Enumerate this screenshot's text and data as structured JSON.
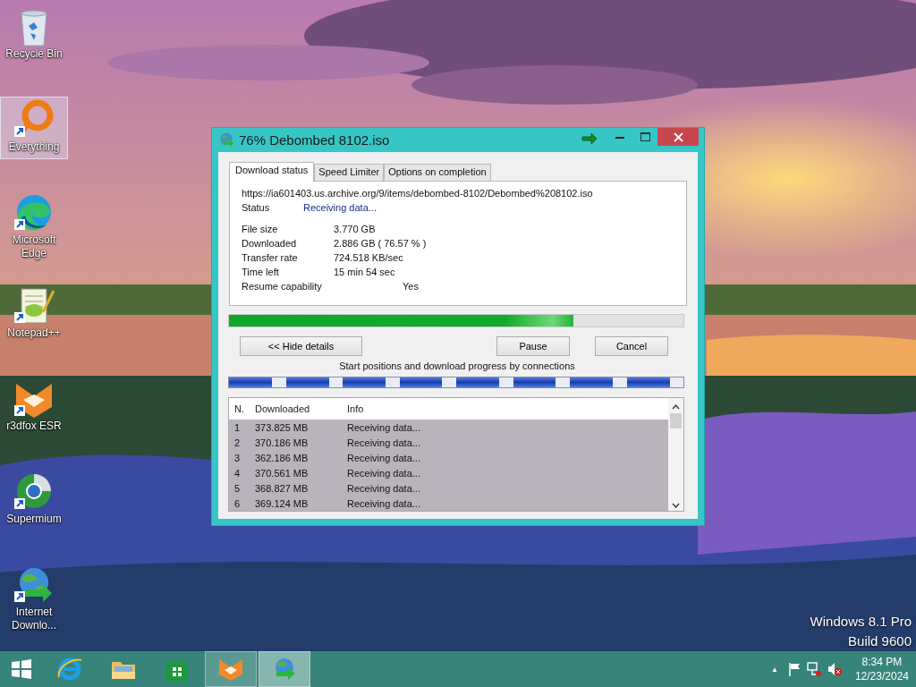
{
  "desktop_icons": [
    {
      "label": "Recycle Bin",
      "kind": "bin",
      "shortcut": false,
      "selected": false
    },
    {
      "label": "Everything",
      "kind": "ring",
      "shortcut": true,
      "selected": true
    },
    {
      "label": "Microsoft Edge",
      "kind": "wave",
      "shortcut": true,
      "selected": false
    },
    {
      "label": "Notepad++",
      "kind": "notepad",
      "shortcut": true,
      "selected": false
    },
    {
      "label": "r3dfox ESR",
      "kind": "fox",
      "shortcut": true,
      "selected": false
    },
    {
      "label": "Supermium",
      "kind": "chrome",
      "shortcut": true,
      "selected": false
    },
    {
      "label": "Internet Downlo...",
      "kind": "globe",
      "shortcut": true,
      "selected": false
    }
  ],
  "window": {
    "title": "76% Debombed 8102.iso",
    "tabs": [
      {
        "label": "Download status",
        "selected": true
      },
      {
        "label": "Speed Limiter",
        "selected": false
      },
      {
        "label": "Options on completion",
        "selected": false
      }
    ],
    "url": "https://ia601403.us.archive.org/9/items/debombed-8102/Debombed%208102.iso",
    "status": {
      "label": "Status",
      "value": "Receiving data..."
    },
    "details": [
      {
        "label": "File size",
        "value": "3.770  GB",
        "kind": "metric"
      },
      {
        "label": "Downloaded",
        "value": "2.886  GB  ( 76.57 % )",
        "kind": "metric"
      },
      {
        "label": "Transfer rate",
        "value": "724.518  KB/sec",
        "kind": "metric"
      },
      {
        "label": "Time left",
        "value": "15 min 54 sec",
        "kind": "metric"
      },
      {
        "label": "Resume capability",
        "value": "Yes",
        "kind": "capability"
      }
    ],
    "progress": {
      "level": 0.757
    },
    "buttons": [
      {
        "label": "<< Hide details",
        "kind": "details"
      },
      {
        "label": "Pause",
        "kind": "action"
      },
      {
        "label": "Cancel",
        "kind": "action"
      }
    ],
    "connections_caption": "Start positions and download progress by connections",
    "connection_segments": [
      {
        "level": 0.76
      },
      {
        "level": 0.76
      },
      {
        "level": 0.76
      },
      {
        "level": 0.75
      },
      {
        "level": 0.75
      },
      {
        "level": 0.75
      },
      {
        "level": 0.75
      },
      {
        "level": 0.76
      }
    ],
    "table": {
      "columns": [
        "N.",
        "Downloaded",
        "Info"
      ],
      "rows": [
        {
          "cells": [
            "1",
            "373.825  MB",
            "Receiving data..."
          ],
          "selected": true
        },
        {
          "cells": [
            "2",
            "370.186  MB",
            "Receiving data..."
          ],
          "selected": true
        },
        {
          "cells": [
            "3",
            "362.186  MB",
            "Receiving data..."
          ],
          "selected": true
        },
        {
          "cells": [
            "4",
            "370.561  MB",
            "Receiving data..."
          ],
          "selected": true
        },
        {
          "cells": [
            "5",
            "368.827  MB",
            "Receiving data..."
          ],
          "selected": true
        },
        {
          "cells": [
            "6",
            "369.124  MB",
            "Receiving data..."
          ],
          "selected": true
        }
      ]
    }
  },
  "os_label": [
    "Windows 8.1 Pro",
    "Build 9600"
  ],
  "taskbar": {
    "items": [
      {
        "kind": "ie",
        "running": false,
        "selected": false
      },
      {
        "kind": "folder",
        "running": false,
        "selected": false
      },
      {
        "kind": "store",
        "running": false,
        "selected": false
      },
      {
        "kind": "fox",
        "running": true,
        "selected": false
      },
      {
        "kind": "globe",
        "running": true,
        "selected": true
      }
    ],
    "tray": {
      "chevron": "▲",
      "time": "8:34 PM",
      "date": "12/23/2024"
    }
  }
}
